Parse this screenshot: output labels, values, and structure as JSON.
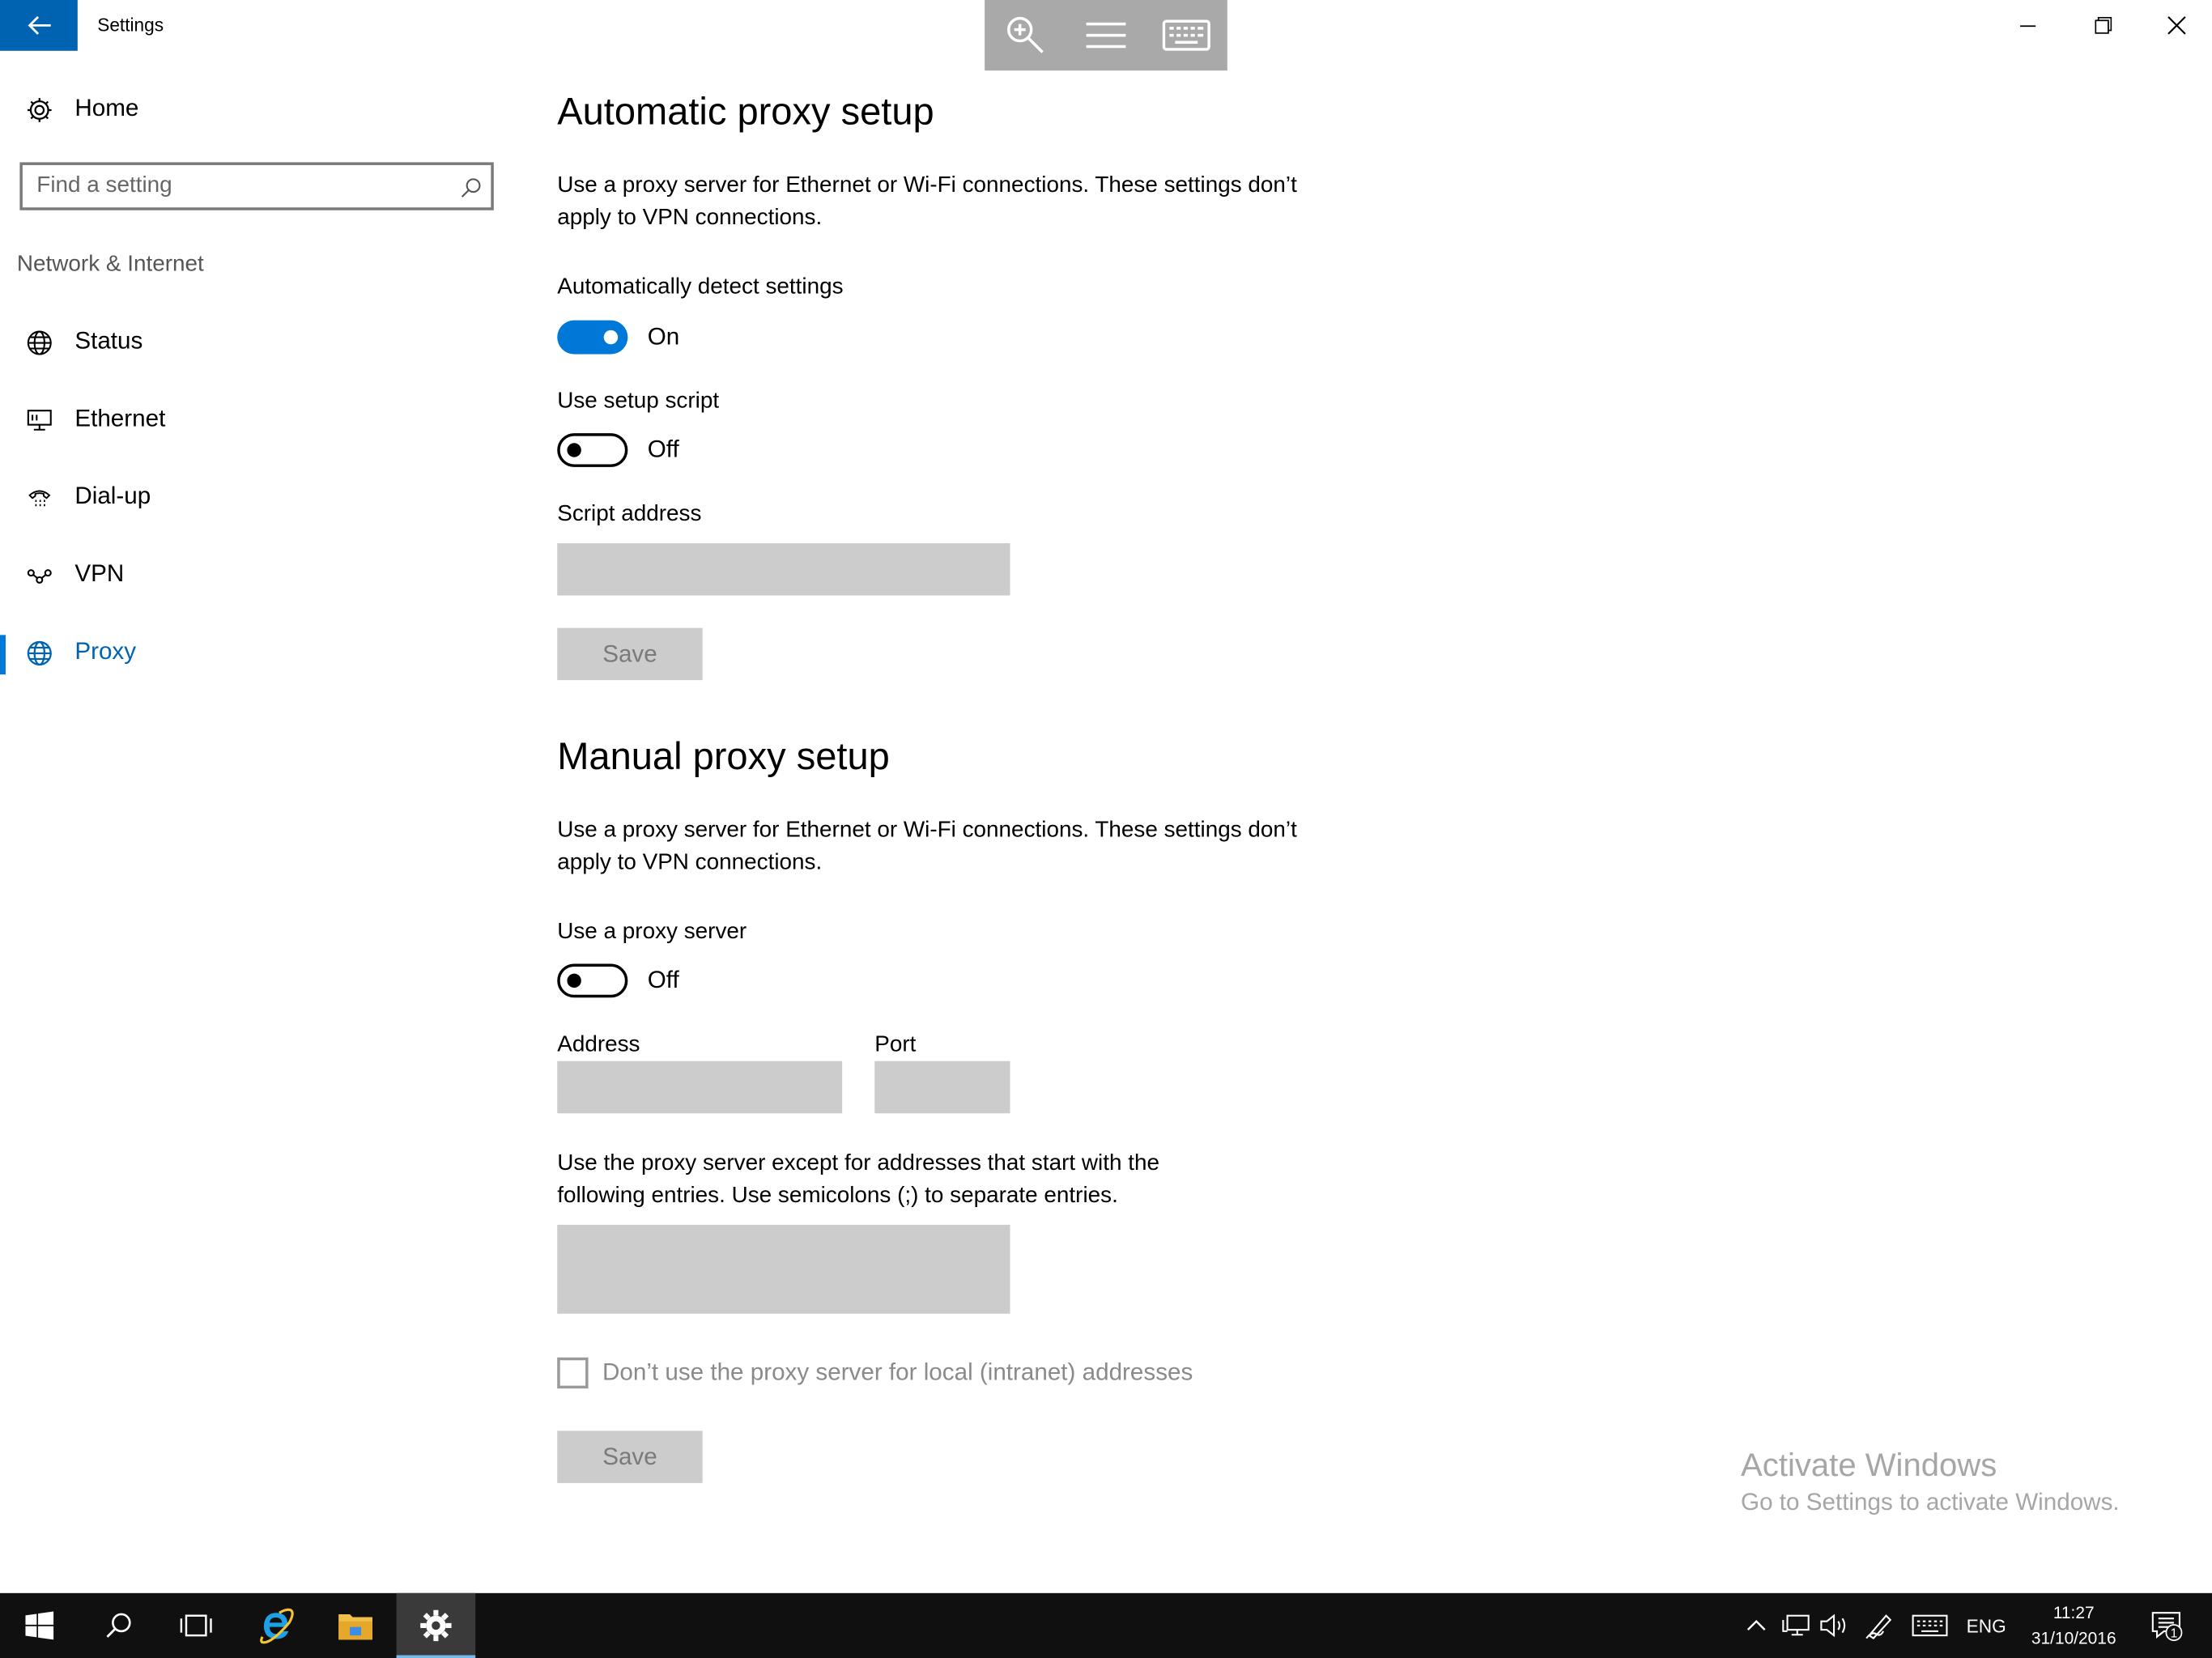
{
  "window": {
    "title": "Settings"
  },
  "sidebar": {
    "home_label": "Home",
    "search_placeholder": "Find a setting",
    "section_label": "Network & Internet",
    "items": [
      {
        "label": "Status",
        "icon": "globe-status-icon"
      },
      {
        "label": "Ethernet",
        "icon": "ethernet-monitor-icon"
      },
      {
        "label": "Dial-up",
        "icon": "dialup-phone-icon"
      },
      {
        "label": "VPN",
        "icon": "vpn-icon"
      },
      {
        "label": "Proxy",
        "icon": "globe-icon",
        "active": true
      }
    ]
  },
  "automatic": {
    "title": "Automatic proxy setup",
    "description": "Use a proxy server for Ethernet or Wi-Fi connections. These settings don’t apply to VPN connections.",
    "detect_label": "Automatically detect settings",
    "detect_state": "On",
    "script_label": "Use setup script",
    "script_state": "Off",
    "address_label": "Script address",
    "address_value": "",
    "save_label": "Save"
  },
  "manual": {
    "title": "Manual proxy setup",
    "description": "Use a proxy server for Ethernet or Wi-Fi connections. These settings don’t apply to VPN connections.",
    "proxy_label": "Use a proxy server",
    "proxy_state": "Off",
    "address_label": "Address",
    "address_value": "",
    "port_label": "Port",
    "port_value": "",
    "exceptions_description": "Use the proxy server except for addresses that start with the following entries. Use semicolons (;) to separate entries.",
    "exceptions_value": "",
    "local_checkbox_label": "Don’t use the proxy server for local (intranet) addresses",
    "local_checkbox_checked": false,
    "save_label": "Save"
  },
  "watermark": {
    "title": "Activate Windows",
    "subtitle": "Go to Settings to activate Windows."
  },
  "taskbar": {
    "language": "ENG",
    "time": "11:27",
    "date": "31/10/2016",
    "notification_count": "1"
  },
  "colors": {
    "accent": "#0078d7",
    "accent_dark": "#0063b1",
    "disabled_fill": "#cccccc",
    "taskbar": "#101010"
  }
}
